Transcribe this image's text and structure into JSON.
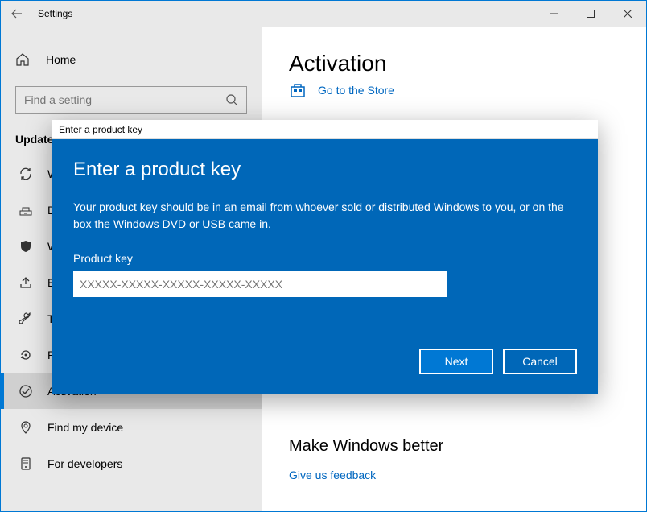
{
  "titlebar": {
    "title": "Settings"
  },
  "sidebar": {
    "home_label": "Home",
    "search_placeholder": "Find a setting",
    "section_header": "Update & Security",
    "items": [
      {
        "label": "Windows Update"
      },
      {
        "label": "Delivery Optimization"
      },
      {
        "label": "Windows Security"
      },
      {
        "label": "Backup"
      },
      {
        "label": "Troubleshoot"
      },
      {
        "label": "Recovery"
      },
      {
        "label": "Activation"
      },
      {
        "label": "Find my device"
      },
      {
        "label": "For developers"
      }
    ]
  },
  "main": {
    "page_title": "Activation",
    "store_link": "Go to the Store",
    "section_title": "Make Windows better",
    "feedback_link": "Give us feedback"
  },
  "modal": {
    "window_title": "Enter a product key",
    "heading": "Enter a product key",
    "body_text": "Your product key should be in an email from whoever sold or distributed Windows to you, or on the box the Windows DVD or USB came in.",
    "field_label": "Product key",
    "input_placeholder": "XXXXX-XXXXX-XXXXX-XXXXX-XXXXX",
    "next_label": "Next",
    "cancel_label": "Cancel"
  }
}
